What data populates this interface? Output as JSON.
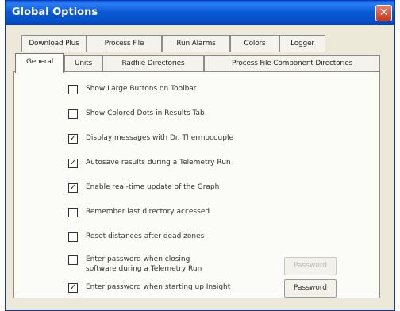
{
  "window": {
    "title": "Global Options"
  },
  "tabs_row1": [
    {
      "label": "Download Plus"
    },
    {
      "label": "Process File"
    },
    {
      "label": "Run Alarms"
    },
    {
      "label": "Colors"
    },
    {
      "label": "Logger"
    }
  ],
  "tabs_row2": [
    {
      "label": "General",
      "active": true
    },
    {
      "label": "Units"
    },
    {
      "label": "Radfile Directories"
    },
    {
      "label": "Process File Component Directories"
    }
  ],
  "options": [
    {
      "label": "Show Large Buttons on Toolbar",
      "checked": false
    },
    {
      "label": "Show Colored Dots in Results Tab",
      "checked": false
    },
    {
      "label": "Display messages with Dr. Thermocouple",
      "checked": true
    },
    {
      "label": "Autosave results during a Telemetry Run",
      "checked": true
    },
    {
      "label": "Enable real-time update of the Graph",
      "checked": true
    },
    {
      "label": "Remember last directory accessed",
      "checked": false
    },
    {
      "label": "Reset distances after dead zones",
      "checked": false
    },
    {
      "label_line1": "Enter password when closing",
      "label_line2": "software during a Telemetry Run",
      "checked": false
    },
    {
      "label": "Enter password when starting up Insight",
      "checked": true
    }
  ],
  "buttons": {
    "password_closing": {
      "label": "Password",
      "enabled": false
    },
    "password_startup": {
      "label": "Password",
      "enabled": true
    }
  },
  "check_mark": "✓"
}
